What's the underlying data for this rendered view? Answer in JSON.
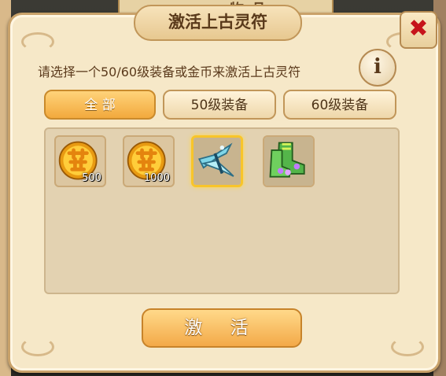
{
  "background": {
    "tab_label": "物品"
  },
  "dialog": {
    "title": "激活上古灵符",
    "close_symbol": "✖",
    "instruction": "请选择一个50/60级装备或金币来激活上古灵符",
    "info_symbol": "i"
  },
  "tabs": [
    {
      "label": "全 部",
      "active": true
    },
    {
      "label": "50级装备",
      "active": false
    },
    {
      "label": "60级装备",
      "active": false
    }
  ],
  "items": [
    {
      "icon": "gold-coin-icon",
      "quantity": "500",
      "selected": false
    },
    {
      "icon": "gold-coin-icon",
      "quantity": "1000",
      "selected": false
    },
    {
      "icon": "crossbow-icon",
      "quantity": "",
      "selected": true
    },
    {
      "icon": "jade-boots-icon",
      "quantity": "",
      "selected": false
    }
  ],
  "activate_label": "激 活",
  "colors": {
    "accent_orange": "#f3a948",
    "selected_border": "#f8c52a",
    "close_red": "#c6141b"
  }
}
